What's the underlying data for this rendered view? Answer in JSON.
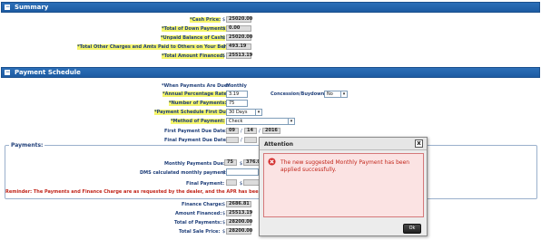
{
  "summary": {
    "title": "Summary",
    "toggle": "−",
    "fields": [
      {
        "label": "*Cash Price:",
        "value": "25020.00"
      },
      {
        "label": "*Total of Down Payments:",
        "value": "0.00"
      },
      {
        "label": "*Unpaid Balance of Cash:",
        "value": "25020.00"
      },
      {
        "label": "*Total Other Charges and Amts Paid to Others on Your Behalf:",
        "value": "493.19"
      },
      {
        "label": "*Total Amount Financed:",
        "value": "25513.19"
      }
    ],
    "currency": "$"
  },
  "schedule": {
    "title": "Payment Schedule",
    "toggle": "−",
    "when_due_label": "*When Payments Are Due:",
    "when_due_value": "Monthly",
    "apr_label": "*Annual Percentage Rate:",
    "apr_value": "3.19",
    "concession_label": "Concession/Buydown:",
    "concession_value": "No",
    "num_payments_label": "*Number of Payments:",
    "num_payments_value": "75",
    "first_due_label": "*Payment Schedule First Due:",
    "first_due_value": "30 Days",
    "method_label": "*Method of Payment:",
    "method_value": "Check",
    "first_date_label": "First Payment Due Date:",
    "first_date_month": "09",
    "first_date_day": "14",
    "first_date_year": "2016",
    "date_sep": "/",
    "final_date_label": "Final Payment Due Date:",
    "final_date_sep": "/"
  },
  "payments": {
    "legend": "Payments:",
    "monthly_label": "Monthly Payments Due:",
    "monthly_count": "75",
    "monthly_amount": "376.0",
    "dms_label": "DMS calculated monthly payment:",
    "final_label": "Final Payment:",
    "currency": "$",
    "reminder": "Reminder: The Payments and Finance Charge are as requested by the dealer, and the APR has been verified to"
  },
  "totals": {
    "fields": [
      {
        "label": "Finance Charge:",
        "value": "2686.81"
      },
      {
        "label": "Amount Financed:",
        "value": "25513.19"
      },
      {
        "label": "Total of Payments:",
        "value": "28200.00"
      },
      {
        "label": "Total Sale Price:",
        "value": "28200.00"
      }
    ],
    "currency": "$"
  },
  "dialog": {
    "title": "Attention",
    "close": "x",
    "message": "The new suggested Monthly Payment has been applied successfully.",
    "ok_label": "Ok",
    "icon": "error-x-circle-icon"
  },
  "colors": {
    "header_blue": "#1d5ba2",
    "highlight": "#f5f56a",
    "label_text": "#21407a",
    "error_red": "#c2271c",
    "error_bg": "#fbe3e3"
  }
}
